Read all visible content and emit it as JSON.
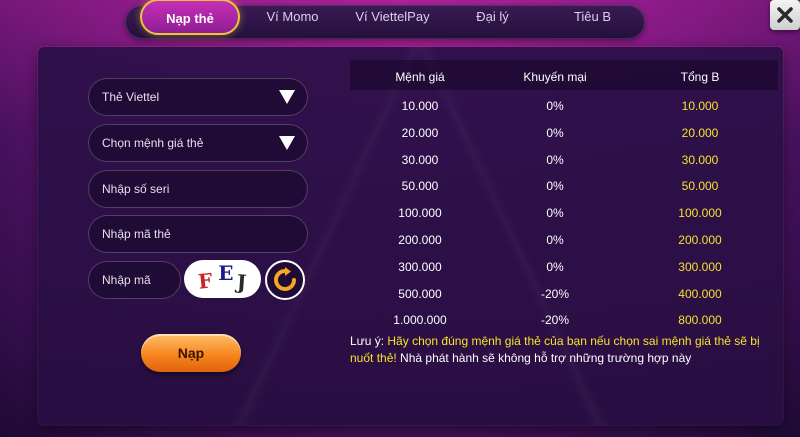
{
  "tabs": [
    {
      "label": "Nạp thẻ",
      "active": true
    },
    {
      "label": "Ví Momo",
      "active": false
    },
    {
      "label": "Ví ViettelPay",
      "active": false
    },
    {
      "label": "Đại lý",
      "active": false
    },
    {
      "label": "Tiêu B",
      "active": false
    }
  ],
  "form": {
    "carrier_select": "Thẻ Viettel",
    "amount_select": "Chọn mệnh giá thẻ",
    "serial_placeholder": "Nhập số seri",
    "code_placeholder": "Nhập mã thẻ",
    "captcha_placeholder": "Nhập mã",
    "captcha_chars": [
      "F",
      "E",
      "J"
    ],
    "captcha_colors": [
      "#c8232c",
      "#1a1a8c",
      "#2a2a2a"
    ],
    "submit_label": "Nạp"
  },
  "rate_table": {
    "headers": [
      "Mệnh giá",
      "Khuyến mại",
      "Tổng B"
    ],
    "rows": [
      [
        "10.000",
        "0%",
        "10.000"
      ],
      [
        "20.000",
        "0%",
        "20.000"
      ],
      [
        "30.000",
        "0%",
        "30.000"
      ],
      [
        "50.000",
        "0%",
        "50.000"
      ],
      [
        "100.000",
        "0%",
        "100.000"
      ],
      [
        "200.000",
        "0%",
        "200.000"
      ],
      [
        "300.000",
        "0%",
        "300.000"
      ],
      [
        "500.000",
        "-20%",
        "400.000"
      ],
      [
        "1.000.000",
        "-20%",
        "800.000"
      ]
    ]
  },
  "note": {
    "prefix": "Lưu ý: ",
    "warning": "Hãy chọn đúng mệnh giá thẻ của bạn nếu chọn sai mệnh giá thẻ sẽ bị nuốt thẻ!",
    "rest": " Nhà phát hành sẽ không hỗ trợ những trường hợp này"
  },
  "colors": {
    "accent_gold": "#f0c23a",
    "value_yellow": "#f6e32b",
    "button_orange": "#f7861e"
  },
  "icons": {
    "close": "close-icon",
    "caret": "caret-down-icon",
    "refresh": "refresh-icon"
  }
}
